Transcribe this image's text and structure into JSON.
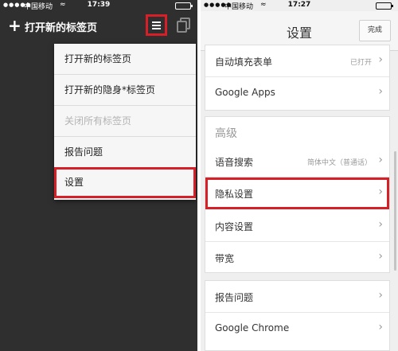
{
  "left_screen": {
    "status_bar": {
      "signal": "●●●●●",
      "carrier": "中国移动",
      "wifi": "wifi-icon",
      "time": "17:39"
    },
    "top_bar": {
      "new_tab_label": "打开新的标签页"
    },
    "menu": [
      {
        "label": "打开新的标签页",
        "disabled": false
      },
      {
        "label": "打开新的隐身*标签页",
        "disabled": false
      },
      {
        "label": "关闭所有标签页",
        "disabled": true
      },
      {
        "label": "报告问题",
        "disabled": false
      },
      {
        "label": "设置",
        "disabled": false,
        "highlighted": true
      }
    ]
  },
  "right_screen": {
    "status_bar": {
      "signal": "●●●●●",
      "carrier": "中国移动",
      "wifi": "wifi-icon",
      "time": "17:27"
    },
    "nav": {
      "title": "设置",
      "done_label": "完成"
    },
    "top_group": [
      {
        "label": "自动填充表单",
        "value": "已打开"
      },
      {
        "label": "Google Apps",
        "value": ""
      }
    ],
    "advanced": {
      "header": "高级",
      "rows": [
        {
          "label": "语音搜索",
          "value": "简体中文（普通话）"
        },
        {
          "label": "隐私设置",
          "value": "",
          "highlighted": true
        },
        {
          "label": "内容设置",
          "value": ""
        },
        {
          "label": "带宽",
          "value": ""
        }
      ]
    },
    "bottom_group": [
      {
        "label": "报告问题",
        "value": ""
      },
      {
        "label": "Google Chrome",
        "value": ""
      }
    ]
  },
  "colors": {
    "highlight": "#d61f26",
    "battery": "#4cd964",
    "dark_bg": "#2f2f2f",
    "light_bg": "#efefef"
  }
}
